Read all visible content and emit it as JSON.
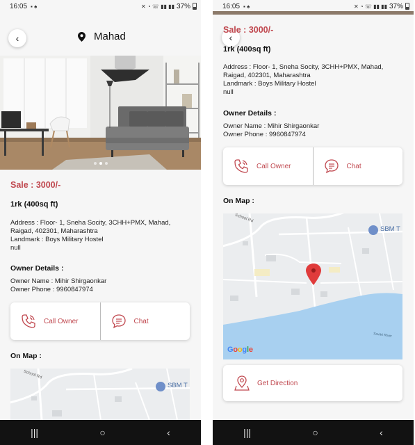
{
  "colors": {
    "accent": "#c0484f",
    "background": "#f6f6f6",
    "water": "#a8d0f0",
    "navbar": "#121212"
  },
  "status_bar": {
    "time": "16:05",
    "battery": "37%"
  },
  "header": {
    "location": "Mahad"
  },
  "listing": {
    "price": "Sale : 3000/-",
    "size": "1rk (400sq ft)",
    "address_line1": "Address : Floor- 1, Sneha Socity, 3CHH+PMX, Mahad,",
    "address_line2": "Raigad, 402301, Maharashtra",
    "landmark": "Landmark : Boys Military Hostel",
    "extra": "null"
  },
  "owner": {
    "title": "Owner Details :",
    "name": "Owner Name : Mihir Shirgaonkar",
    "phone": "Owner Phone : 9960847974"
  },
  "actions": {
    "call": "Call Owner",
    "chat": "Chat",
    "direction": "Get Direction"
  },
  "map": {
    "title": "On Map :",
    "road_label": "School Rd",
    "poi_label": "SBM T",
    "river_label": "Savitri River",
    "attribution": "Google"
  },
  "carousel": {
    "slides": 3,
    "active_index": 1
  },
  "nav": {
    "recents": "|||",
    "home": "○",
    "back": "‹"
  }
}
